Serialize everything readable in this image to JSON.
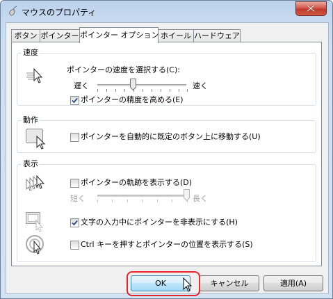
{
  "window": {
    "title": "マウスのプロパティ"
  },
  "tabs": [
    {
      "label": "ボタン"
    },
    {
      "label": "ポインター"
    },
    {
      "label": "ポインター オプション",
      "active": true
    },
    {
      "label": "ホイール"
    },
    {
      "label": "ハードウェア"
    }
  ],
  "speed": {
    "group_label": "速度",
    "prompt": "ポインターの速度を選択する(C):",
    "slow_label": "遅く",
    "fast_label": "速く",
    "slider_fraction": 0.4,
    "precision_label": "ポインターの精度を高める(E)",
    "precision_checked": true
  },
  "motion": {
    "group_label": "動作",
    "snap_label": "ポインターを自動的に既定のボタン上に移動する(U)",
    "snap_checked": false
  },
  "visibility": {
    "group_label": "表示",
    "trails_label": "ポインターの軌跡を表示する(D)",
    "trails_checked": false,
    "short_label": "短く",
    "long_label": "長く",
    "trails_fraction": 1.0,
    "hide_typing_label": "文字の入力中にポインターを非表示にする(H)",
    "hide_typing_checked": true,
    "ctrl_label": "Ctrl キーを押すとポインターの位置を表示する(S)",
    "ctrl_checked": false
  },
  "buttons": {
    "ok": "OK",
    "cancel": "キャンセル",
    "apply": "適用(A)"
  },
  "colors": {
    "highlight": "#e8232a",
    "check": "#2a4b87"
  }
}
